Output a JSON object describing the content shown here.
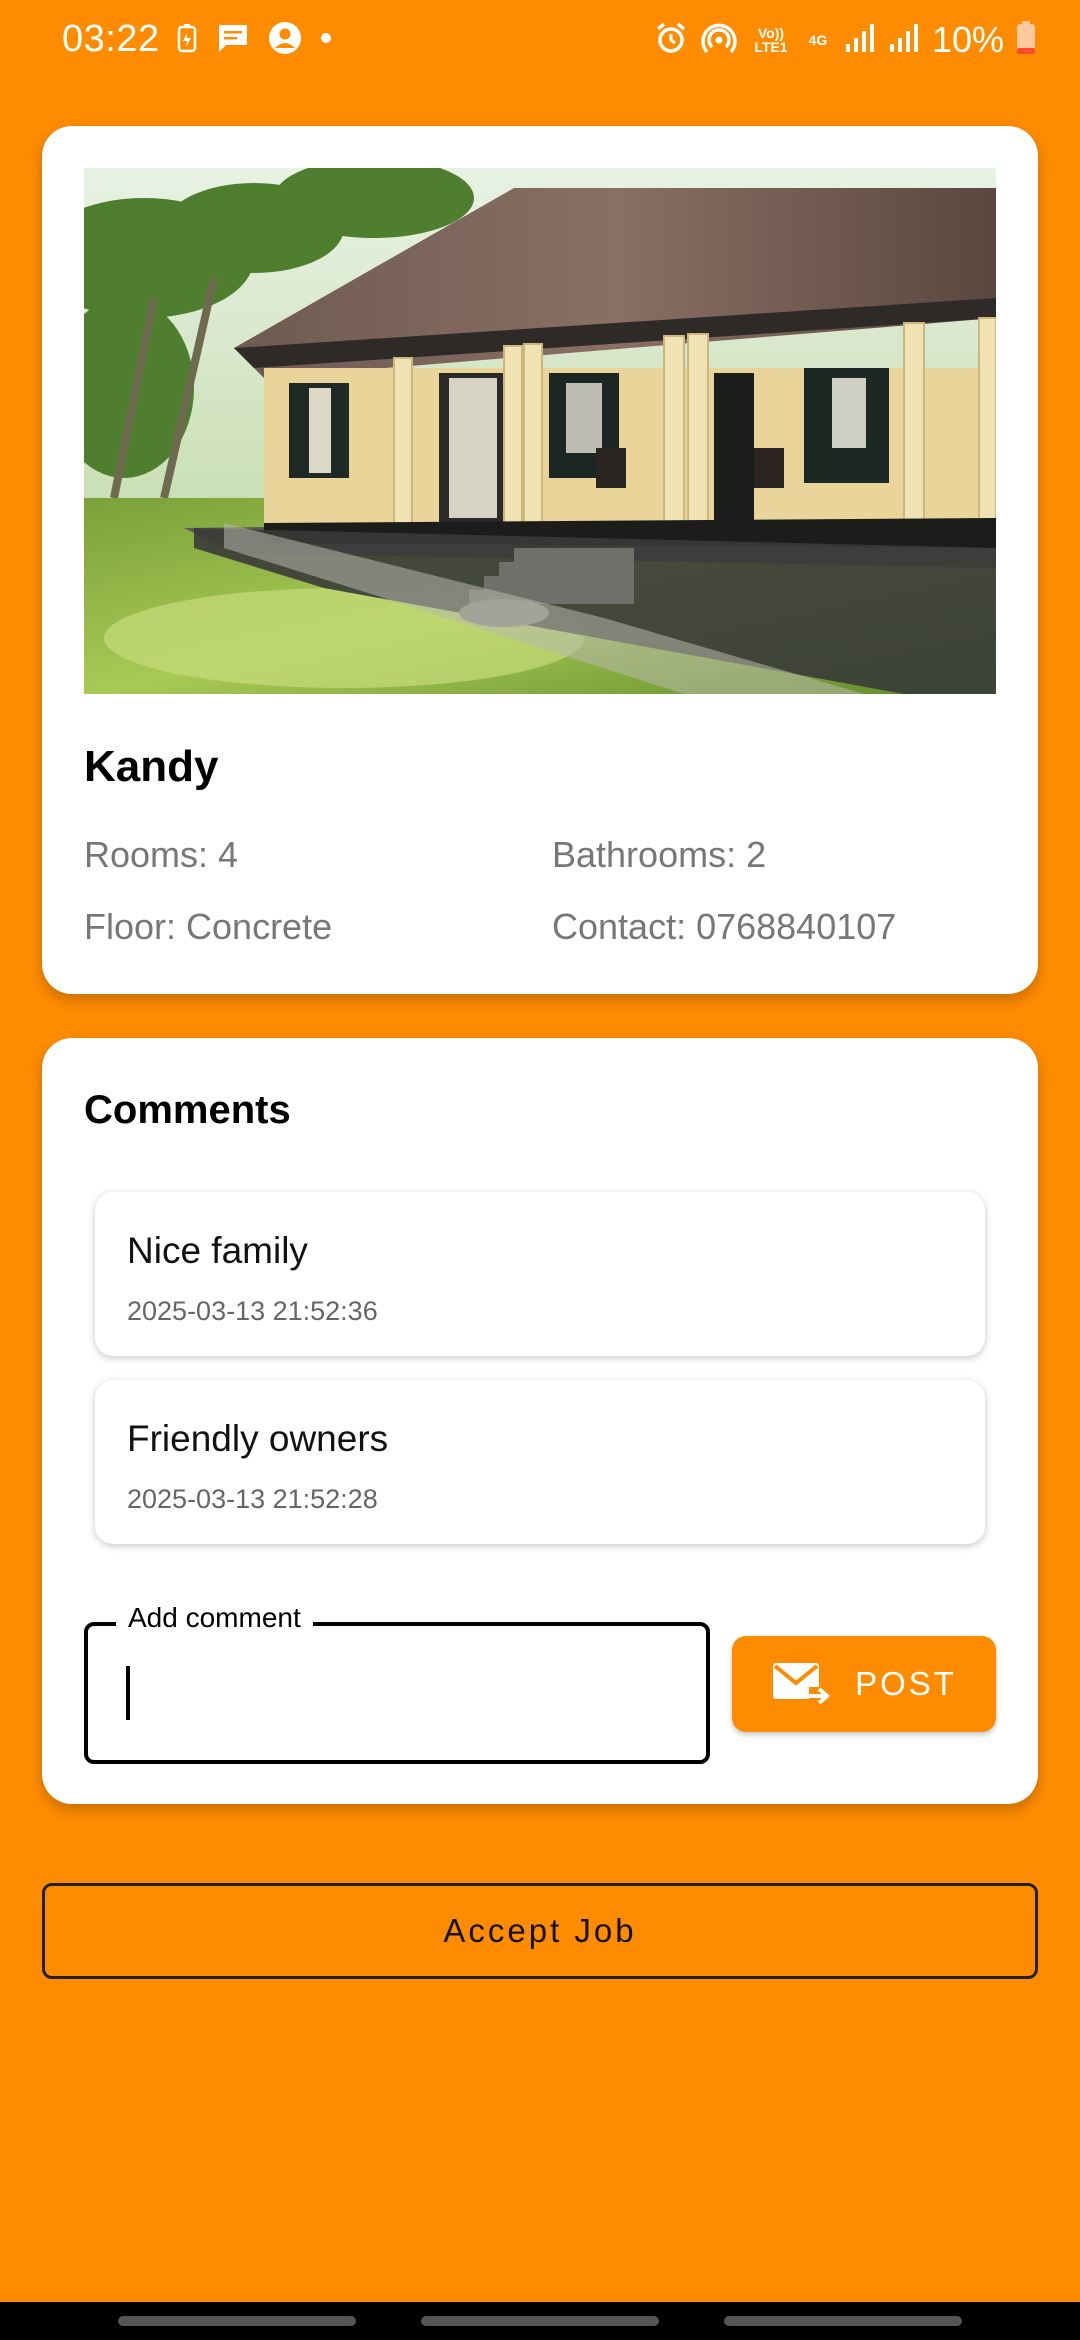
{
  "status_bar": {
    "time": "03:22",
    "battery": "10%",
    "net_volte": "Vo)) LTE1",
    "net_4g": "4G",
    "left_icons": [
      "battery-saver-icon",
      "message-icon",
      "account-icon",
      "dot-icon"
    ],
    "right_icons": [
      "alarm-icon",
      "hotspot-icon",
      "volte-icon",
      "4g-icon",
      "signal-icon",
      "signal-icon",
      "battery-icon"
    ]
  },
  "house": {
    "image_icon": "house-photo",
    "title": "Kandy",
    "rooms": "Rooms: 4",
    "bathrooms": "Bathrooms: 2",
    "floor": "Floor: Concrete",
    "contact": "Contact: 0768840107"
  },
  "comments": {
    "title": "Comments",
    "items": [
      {
        "text": "Nice family",
        "time": "2025-03-13 21:52:36"
      },
      {
        "text": "Friendly owners",
        "time": "2025-03-13 21:52:28"
      }
    ],
    "input": {
      "label": "Add comment",
      "value": ""
    },
    "post_label": "POST",
    "post_icon": "mail-send-icon"
  },
  "accept_label": "Accept Job",
  "colors": {
    "background": "#FF8C00",
    "card": "#FFFFFF",
    "button": "#FF8C00"
  }
}
